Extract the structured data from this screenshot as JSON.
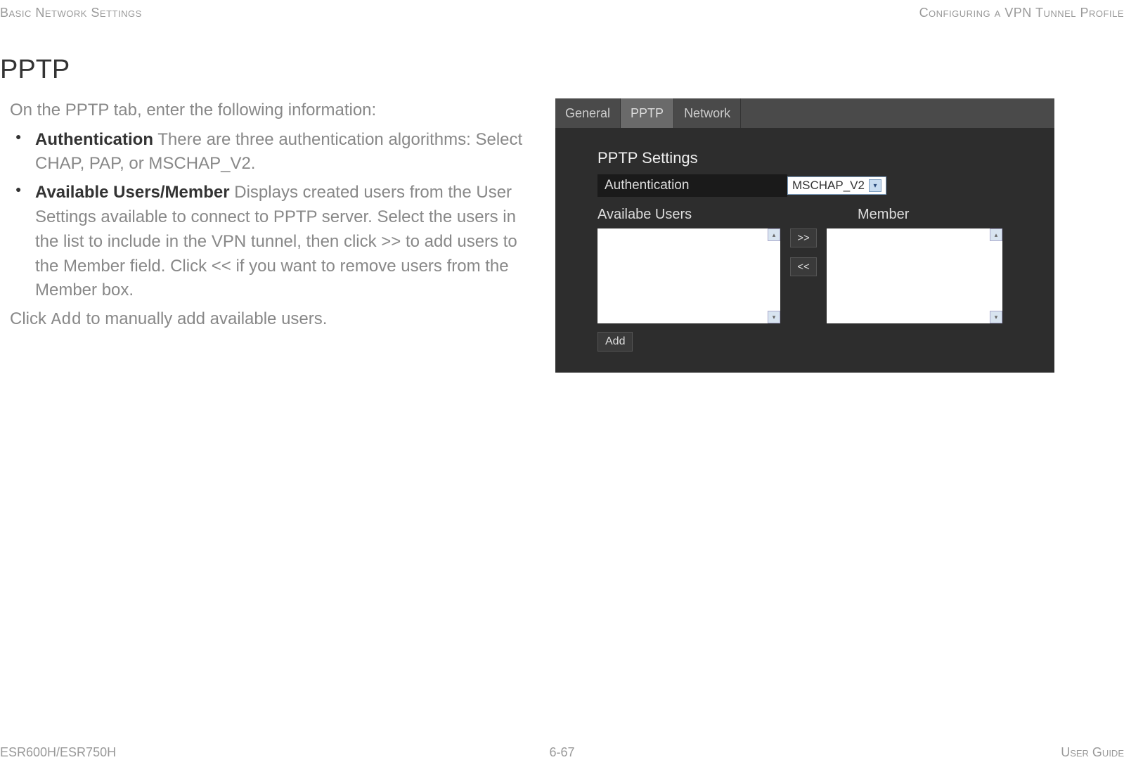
{
  "header": {
    "left": "Basic Network Settings",
    "right": "Configuring a VPN Tunnel Profile"
  },
  "section_title": "PPTP",
  "intro": "On the PPTP tab, enter the following information:",
  "bullets": [
    {
      "term": "Authentication",
      "desc": "  There are three authentication algorithms: Select CHAP, PAP, or MSCHAP_V2."
    },
    {
      "term": "Available Users/Member",
      "desc": "  Displays created users from the User Settings available to connect to PPTP server. Select the users in the list to include in the VPN tunnel, then click >> to add users to the Member field. Click << if you want to remove users from the Member box."
    }
  ],
  "closing_pre": "Click ",
  "closing_code": "Add",
  "closing_post": " to manually add available users.",
  "screenshot": {
    "tabs": [
      "General",
      "PPTP",
      "Network"
    ],
    "active_tab": "PPTP",
    "settings_title": "PPTP Settings",
    "auth_label": "Authentication",
    "auth_value": "MSCHAP_V2",
    "available_label": "Availabe Users",
    "member_label": "Member",
    "move_right": ">>",
    "move_left": "<<",
    "add_label": "Add"
  },
  "footer": {
    "left": "ESR600H/ESR750H",
    "center": "6-67",
    "right": "User Guide"
  }
}
